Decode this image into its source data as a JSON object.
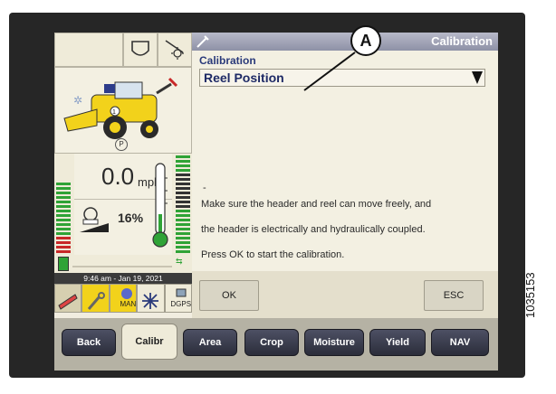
{
  "right_panel": {
    "header_title": "Calibration",
    "section_label": "Calibration",
    "dropdown_value": "Reel Position",
    "message_lines": [
      "Make sure the header and reel can move freely, and",
      "the header is electrically and hydraulically coupled.",
      "Press OK to start the calibration."
    ],
    "dash": "-",
    "ok_label": "OK",
    "esc_label": "ESC"
  },
  "left_panel": {
    "gear": "P",
    "speed_value": "0.0",
    "speed_unit": "mph",
    "load_percent": "16%",
    "datetime": "9:46 am - Jan 19, 2021",
    "bottom_icons": [
      "combine-settings-icon",
      "wrench-icon",
      "steering-icon",
      "rotor-icon",
      "dgps-icon"
    ],
    "man_label": "MAN",
    "dgps_label": "DGPS",
    "fuel_gauge_level": 0.5
  },
  "nav": {
    "tabs": [
      "Back",
      "Calibr",
      "Area",
      "Crop",
      "Moisture",
      "Yield",
      "NAV"
    ],
    "active": "Calibr"
  },
  "callout_letter": "A",
  "figure_id": "1035153",
  "colors": {
    "header_blue": "#8e91a6",
    "text_blue": "#1e2a66",
    "nav_dark": "#2b2d3a",
    "combine_yellow": "#f2d21b",
    "gauge_green": "#2fa336"
  }
}
